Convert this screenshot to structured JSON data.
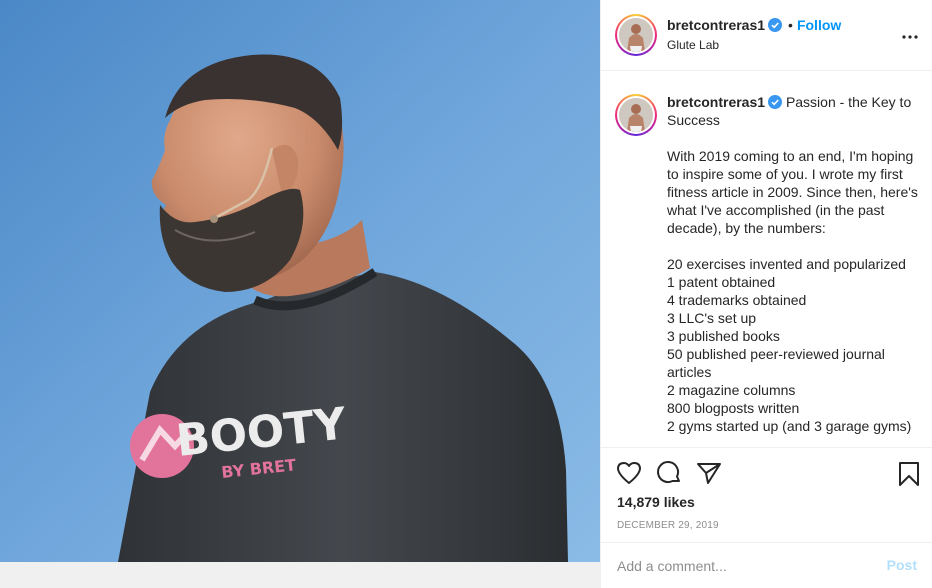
{
  "post": {
    "username": "bretcontreras1",
    "follow_separator": "•",
    "follow_label": "Follow",
    "location": "Glute Lab",
    "more_icon": "more-horizontal-icon",
    "shirt_text_main": "BOOTY",
    "shirt_text_sub": "BY BRET"
  },
  "caption": {
    "username": "bretcontreras1",
    "title": "Passion - the Key to Success",
    "lines": [
      "With 2019 coming to an end, I'm hoping to inspire some of you. I wrote my first fitness article in 2009. Since then, here's what I've accomplished (in the past decade), by the numbers:",
      "",
      "20 exercises invented and popularized",
      "1 patent obtained",
      "4 trademarks obtained",
      "3 LLC's set up",
      "3 published books",
      "50 published peer-reviewed journal articles",
      "2 magazine columns",
      "800 blogposts written",
      "2 gyms started up (and 3 garage gyms)"
    ]
  },
  "actions": {
    "like_icon": "heart-icon",
    "comment_icon": "comment-icon",
    "share_icon": "share-icon",
    "save_icon": "bookmark-icon",
    "likes": "14,879 likes",
    "date": "DECEMBER 29, 2019"
  },
  "comment_box": {
    "placeholder": "Add a comment...",
    "post_label": "Post"
  },
  "colors": {
    "accent": "#0095f6",
    "post_disabled": "#b2dffc",
    "sky": "#6fa4d6",
    "shirt": "#3b3e42",
    "logo_pink": "#e2739b"
  }
}
